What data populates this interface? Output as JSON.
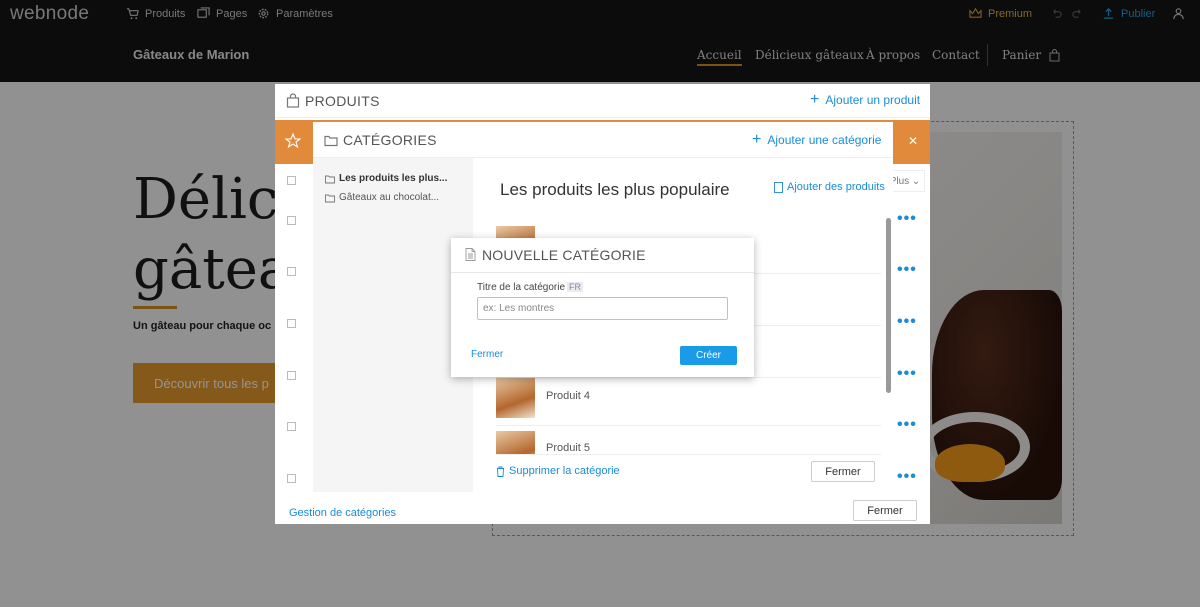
{
  "topbar": {
    "logo": "webnode",
    "products": "Produits",
    "pages": "Pages",
    "settings": "Paramètres",
    "premium": "Premium",
    "publish": "Publier"
  },
  "site": {
    "name": "Gâteaux de Marion",
    "nav": [
      "Accueil",
      "Délicieux gâteaux",
      "À propos",
      "Contact"
    ],
    "cart": "Panier"
  },
  "hero": {
    "title_line1": "Délici",
    "title_line2": "gâteau",
    "subtitle": "Un gâteau pour chaque oc",
    "button": "Découvrir tous les p"
  },
  "products_panel": {
    "title": "PRODUITS",
    "add_product": "Ajouter un produit",
    "plus": "Plus",
    "manage_categories": "Gestion de catégories",
    "close": "Fermer"
  },
  "categories_panel": {
    "title": "CATÉGORIES",
    "add_category": "Ajouter une catégorie",
    "categories": [
      "Les produits les plus...",
      "Gâteaux au chocolat..."
    ],
    "selected_title": "Les produits les plus populaire",
    "add_products": "Ajouter des produits",
    "products": [
      "Produit 4",
      "Produit 5"
    ],
    "delete_category": "Supprimer la catégorie",
    "close": "Fermer"
  },
  "modal": {
    "title": "NOUVELLE CATÉGORIE",
    "field_label": "Titre de la catégorie",
    "lang": "FR",
    "placeholder": "ex: Les montres",
    "value": "",
    "close": "Fermer",
    "create": "Créer"
  },
  "colors": {
    "accent": "#1a9be8",
    "brand_orange": "#e39a2c",
    "notice_orange": "#e28a3c"
  }
}
